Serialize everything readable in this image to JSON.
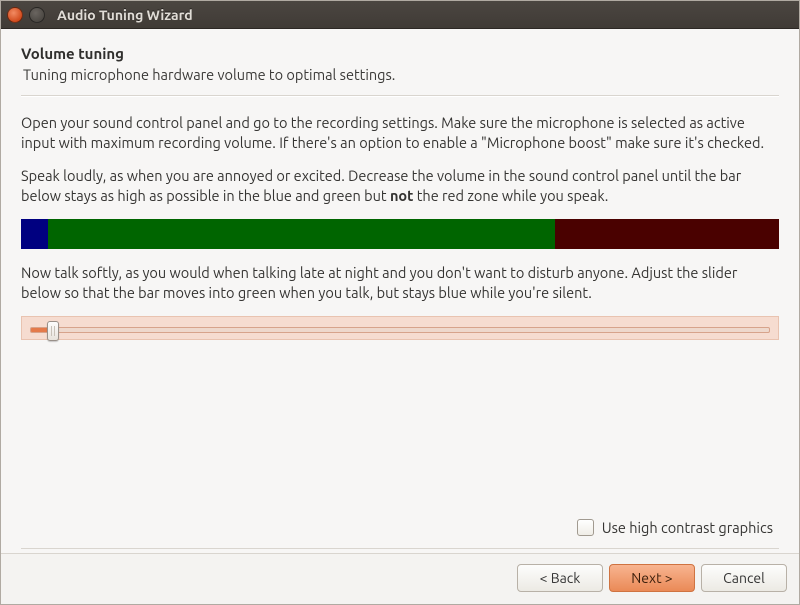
{
  "window": {
    "title": "Audio Tuning Wizard"
  },
  "header": {
    "title": "Volume tuning",
    "subtitle": "Tuning microphone hardware volume to optimal settings."
  },
  "body": {
    "para1": "Open your sound control panel and go to the recording settings. Make sure the microphone is selected as active input with maximum recording volume. If there's an option to enable a \"Microphone boost\" make sure it's checked.",
    "para2_pre": "Speak loudly, as when you are annoyed or excited. Decrease the volume in the sound control panel until the bar below stays as high as possible in the blue and green but ",
    "para2_bold": "not",
    "para2_post": " the red zone while you speak.",
    "para3": "Now talk softly, as you would when talking late at night and you don't want to disturb anyone. Adjust the slider below so that the bar moves into green when you talk, but stays blue while you're silent."
  },
  "meter": {
    "blue_pct": 3.5,
    "green_pct": 67
  },
  "slider": {
    "value_pct": 3
  },
  "checkbox": {
    "label": "Use high contrast graphics",
    "checked": false
  },
  "buttons": {
    "back": "< Back",
    "next": "Next >",
    "cancel": "Cancel"
  }
}
